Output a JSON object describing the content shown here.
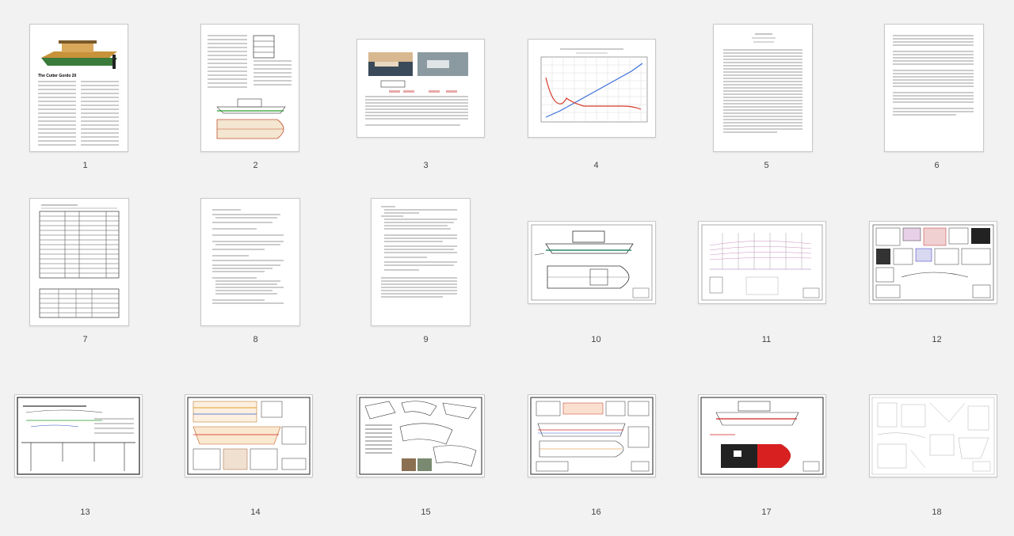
{
  "pages": [
    {
      "label": "1"
    },
    {
      "label": "2"
    },
    {
      "label": "3"
    },
    {
      "label": "4"
    },
    {
      "label": "5"
    },
    {
      "label": "6"
    },
    {
      "label": "7"
    },
    {
      "label": "8"
    },
    {
      "label": "9"
    },
    {
      "label": "10"
    },
    {
      "label": "11"
    },
    {
      "label": "12"
    },
    {
      "label": "13"
    },
    {
      "label": "14"
    },
    {
      "label": "15"
    },
    {
      "label": "16"
    },
    {
      "label": "17"
    },
    {
      "label": "18"
    }
  ],
  "page1": {
    "title": "The Cutter Gordo 20"
  },
  "colors": {
    "background": "#f2f2f2",
    "hull_green": "#3a7a3a",
    "cabin_tan": "#c8923a",
    "chart_blue": "#3a6fd8",
    "chart_red": "#d83a2a",
    "plan_red": "#d82020"
  }
}
